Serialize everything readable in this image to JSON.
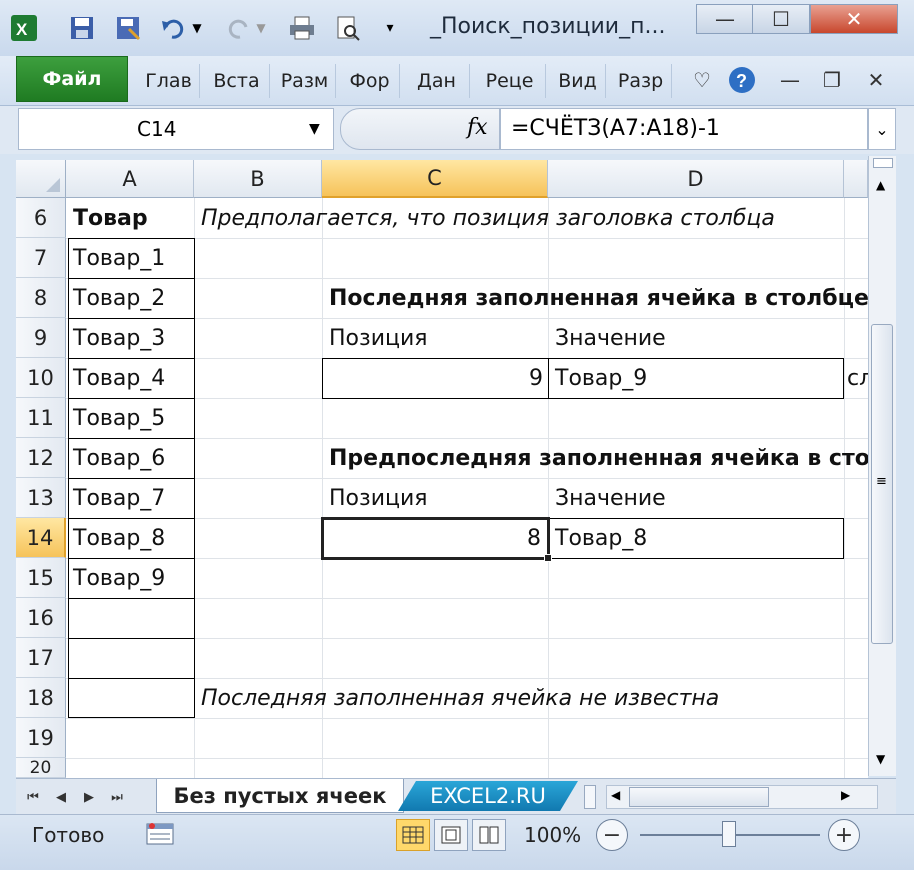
{
  "window": {
    "title": "_Поиск_позиции_п...",
    "controls": {
      "minimize": "—",
      "maximize": "☐",
      "close": "✕"
    }
  },
  "ribbon": {
    "file_tab": "Файл",
    "tabs": [
      "Глав",
      "Вста",
      "Разм",
      "Фор",
      "Дан",
      "Реце",
      "Вид",
      "Разр"
    ]
  },
  "formula_bar": {
    "name_box": "C14",
    "fx": "fx",
    "formula": "=СЧЁТЗ(A7:A18)-1"
  },
  "columns": [
    "A",
    "B",
    "C",
    "D"
  ],
  "active_column": "C",
  "rows": [
    "6",
    "7",
    "8",
    "9",
    "10",
    "11",
    "12",
    "13",
    "14",
    "15",
    "16",
    "17",
    "18",
    "19",
    "20"
  ],
  "active_row": "14",
  "cells": {
    "A6": "Товар",
    "B6": "Предполагается, что позиция заголовка столбца",
    "A7": "Товар_1",
    "A8": "Товар_2",
    "C8": "Последняя заполненная ячейка в столбце",
    "A9": "Товар_3",
    "C9": "Позиция",
    "D9": "Значение",
    "A10": "Товар_4",
    "C10": "9",
    "D10": "Товар_9",
    "E10": "сл",
    "A11": "Товар_5",
    "A12": "Товар_6",
    "C12": "Предпоследняя заполненная ячейка в сто",
    "A13": "Товар_7",
    "C13": "Позиция",
    "D13": "Значение",
    "A14": "Товар_8",
    "C14": "8",
    "D14": "Товар_8",
    "A15": "Товар_9",
    "B18": "Последняя заполненная ячейка не известна"
  },
  "sheet_tabs": {
    "active": "Без пустых ячеек",
    "other": "EXCEL2.RU"
  },
  "status_bar": {
    "status": "Готово",
    "zoom": "100%",
    "zoom_minus": "−",
    "zoom_plus": "+"
  },
  "colors": {
    "file_tab": "#2a8a2d",
    "active_header": "#f6c35a",
    "excel_tab": "#1a8fc6"
  }
}
